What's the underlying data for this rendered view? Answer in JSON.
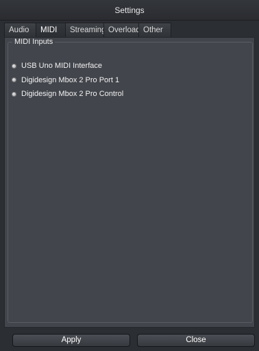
{
  "window": {
    "title": "Settings"
  },
  "tabs": [
    {
      "label": "Audio"
    },
    {
      "label": "MIDI"
    },
    {
      "label": "Streaming"
    },
    {
      "label": "Overload"
    },
    {
      "label": "Other"
    }
  ],
  "active_tab": "MIDI",
  "midi_inputs": {
    "label": "MIDI Inputs",
    "items": [
      {
        "label": "USB Uno MIDI Interface",
        "indicator": "dot-icon"
      },
      {
        "label": "Digidesign Mbox 2 Pro Port 1",
        "indicator": "dot-icon"
      },
      {
        "label": "Digidesign Mbox 2 Pro Control",
        "indicator": "dot-icon"
      }
    ]
  },
  "buttons": {
    "apply": "Apply",
    "close": "Close"
  },
  "colors": {
    "panel": "#42454b",
    "window": "#2b2e33",
    "text": "#ffffff"
  }
}
